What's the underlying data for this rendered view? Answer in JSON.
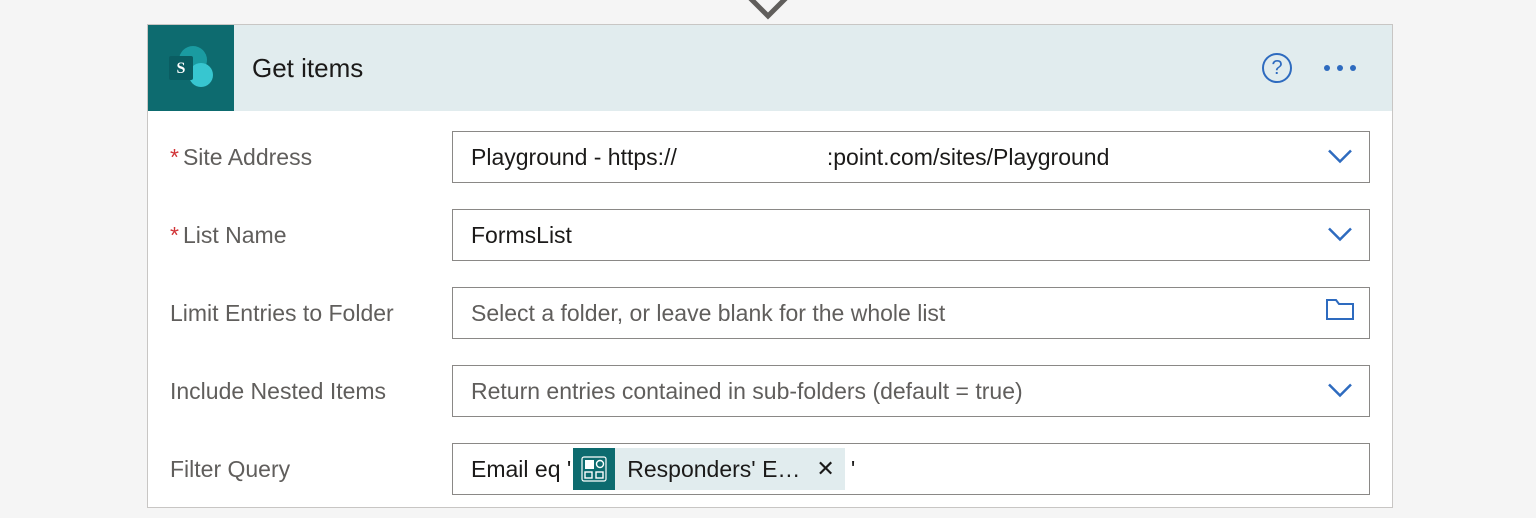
{
  "header": {
    "title": "Get items"
  },
  "fields": {
    "site_address": {
      "label": "Site Address",
      "required": true,
      "value_left": "Playground - https://",
      "value_right": ":point.com/sites/Playground"
    },
    "list_name": {
      "label": "List Name",
      "required": true,
      "value": "FormsList"
    },
    "limit_entries": {
      "label": "Limit Entries to Folder",
      "placeholder": "Select a folder, or leave blank for the whole list"
    },
    "include_nested": {
      "label": "Include Nested Items",
      "placeholder": "Return entries contained in sub-folders (default = true)"
    },
    "filter_query": {
      "label": "Filter Query",
      "prefix": "Email eq '",
      "token_label": "Responders' E…",
      "suffix": "'"
    }
  },
  "required_marker": "*"
}
